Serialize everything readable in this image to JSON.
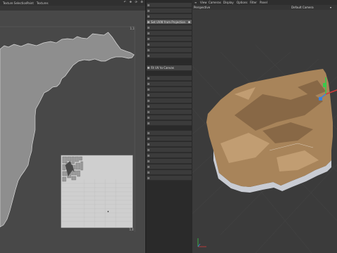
{
  "uv_editor": {
    "menu": [
      "Texture Selection",
      "Paint",
      "Textures"
    ],
    "corner_labels": {
      "top_right": "1,1",
      "bottom_right": "1,0"
    },
    "toolbar_icons": [
      "undo-icon",
      "hand-icon",
      "pin-icon",
      "rotate-icon",
      "move-icon",
      "gear-icon"
    ]
  },
  "tool_panel": {
    "highlighted_item": "Set UVW from Projection",
    "bright_item": "Fit UV to Canvas"
  },
  "viewport": {
    "menu": [
      "View",
      "Cameras",
      "Display",
      "Options",
      "Filter",
      "Panel"
    ],
    "view_name": "Perspective",
    "camera_name": "Default Camera",
    "axis_colors": {
      "x": "#d23b3b",
      "y": "#39c84a",
      "z": "#3a82e0"
    }
  },
  "colors": {
    "highlight": "#5a5a5a",
    "terrain": "#a8845a",
    "terrain_side": "#c9ccd3"
  }
}
